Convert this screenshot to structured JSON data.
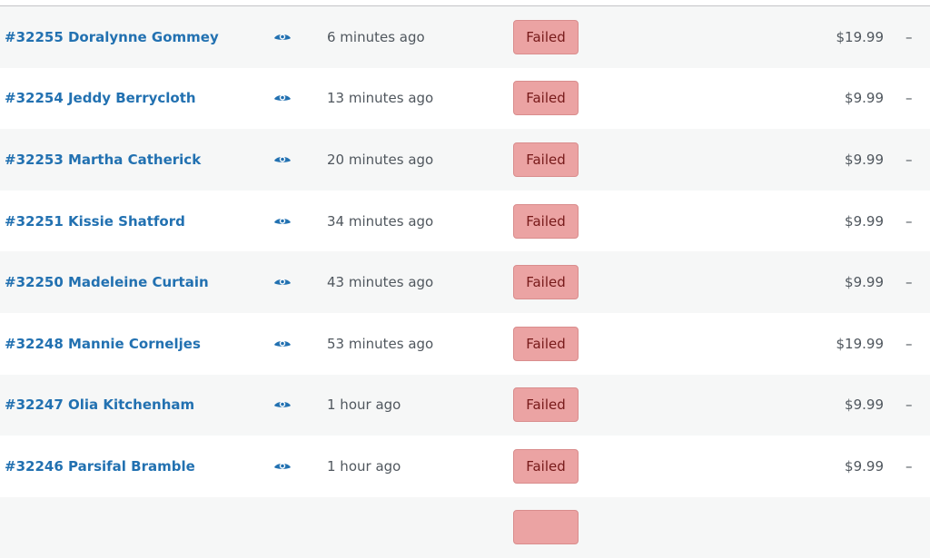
{
  "colors": {
    "link": "#2271b1",
    "failed_bg": "#eba3a3",
    "failed_text": "#761919",
    "row_alt_bg": "#f6f7f7"
  },
  "orders": [
    {
      "order": "#32255 Doralynne Gommey",
      "preview_icon": "eye-icon",
      "date": "6 minutes ago",
      "status": "Failed",
      "total": "$19.99",
      "extra": "–"
    },
    {
      "order": "#32254 Jeddy Berrycloth",
      "preview_icon": "eye-icon",
      "date": "13 minutes ago",
      "status": "Failed",
      "total": "$9.99",
      "extra": "–"
    },
    {
      "order": "#32253 Martha Catherick",
      "preview_icon": "eye-icon",
      "date": "20 minutes ago",
      "status": "Failed",
      "total": "$9.99",
      "extra": "–"
    },
    {
      "order": "#32251 Kissie Shatford",
      "preview_icon": "eye-icon",
      "date": "34 minutes ago",
      "status": "Failed",
      "total": "$9.99",
      "extra": "–"
    },
    {
      "order": "#32250 Madeleine Curtain",
      "preview_icon": "eye-icon",
      "date": "43 minutes ago",
      "status": "Failed",
      "total": "$9.99",
      "extra": "–"
    },
    {
      "order": "#32248 Mannie Corneljes",
      "preview_icon": "eye-icon",
      "date": "53 minutes ago",
      "status": "Failed",
      "total": "$19.99",
      "extra": "–"
    },
    {
      "order": "#32247 Olia Kitchenham",
      "preview_icon": "eye-icon",
      "date": "1 hour ago",
      "status": "Failed",
      "total": "$9.99",
      "extra": "–"
    },
    {
      "order": "#32246 Parsifal Bramble",
      "preview_icon": "eye-icon",
      "date": "1 hour ago",
      "status": "Failed",
      "total": "$9.99",
      "extra": "–"
    },
    {
      "order": "",
      "preview_icon": "",
      "date": "",
      "status": "",
      "total": "",
      "extra": ""
    }
  ]
}
